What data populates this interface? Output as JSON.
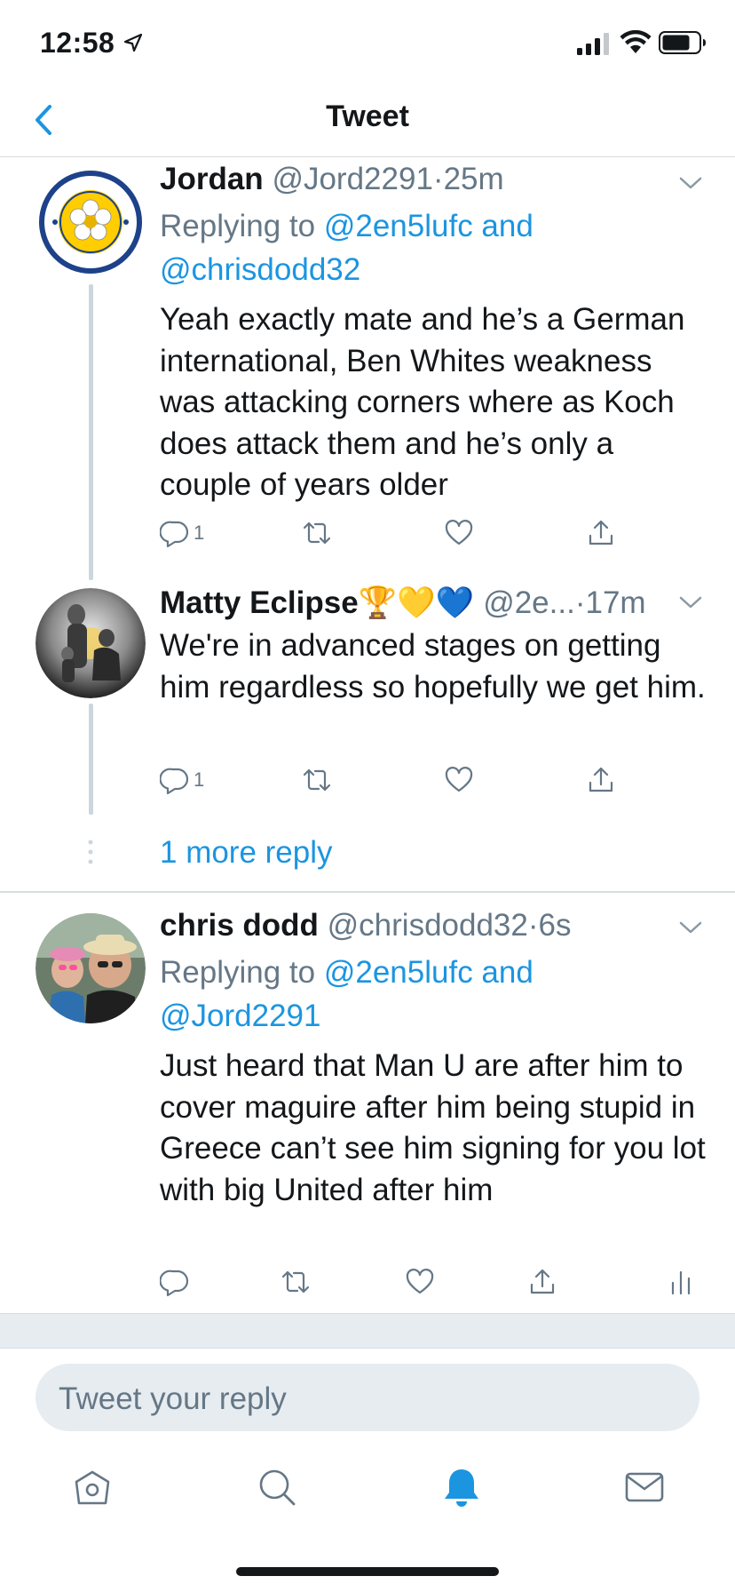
{
  "status_bar": {
    "time": "12:58"
  },
  "header": {
    "title": "Tweet"
  },
  "tweets": [
    {
      "name": "Jordan",
      "handle": "@Jord2291",
      "separator": "·",
      "time": "25m",
      "replying_prefix": "Replying to",
      "replying_to_1": "@2en5lufc and",
      "replying_to_2": "@chrisdodd32",
      "text": "Yeah exactly mate and he’s a German international, Ben Whites weakness was attacking corners where as Koch does attack them and he’s only a couple of years older",
      "reply_count": "1"
    },
    {
      "name": "Matty Eclipse",
      "emojis": "🏆💛💙",
      "handle": "@2e...",
      "separator": "·",
      "time": "17m",
      "text": "We're in advanced stages on getting him regardless so hopefully we get him.",
      "reply_count": "1"
    },
    {
      "name": "chris dodd",
      "handle": "@chrisdodd32",
      "separator": "·",
      "time": "6s",
      "replying_prefix": "Replying to",
      "replying_to_1": "@2en5lufc and",
      "replying_to_2": "@Jord2291",
      "text": "Just heard that Man U are after him to cover maguire after him being stupid in Greece can’t see him signing for you lot with big United after him"
    }
  ],
  "more_replies": "1 more reply",
  "reply_box": {
    "placeholder": "Tweet your reply"
  },
  "colors": {
    "accent": "#1b95e0",
    "secondary_text": "#657786",
    "divider": "#d8dde1"
  }
}
